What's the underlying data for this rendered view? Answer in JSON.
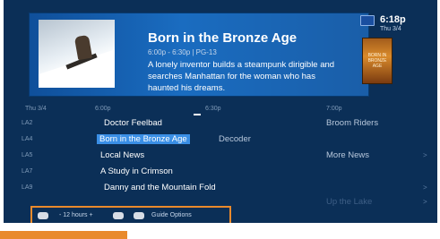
{
  "clock": {
    "time": "6:18p",
    "date": "Thu 3/4"
  },
  "info": {
    "title": "Born in the Bronze Age",
    "meta": "6:00p - 6:30p  |  PG-13",
    "description": "A lonely inventor builds a steampunk dirigible and searches Manhattan for the woman who has haunted his dreams.",
    "poster_text": "BORN IN BRONZE AGE"
  },
  "timeline": [
    "Thu 3/4",
    "6:00p",
    "6:30p",
    "7:00p"
  ],
  "rows": [
    {
      "channel": "LA2",
      "program": "Doctor Feelbad",
      "next": "Broom Riders",
      "arrow": ""
    },
    {
      "channel": "LA4",
      "program": "Born in the Bronze Age",
      "next": "Decoder",
      "arrow": ""
    },
    {
      "channel": "LA5",
      "program": "Local News",
      "next": "More News",
      "arrow": ">"
    },
    {
      "channel": "LA7",
      "program": "A Study in Crimson",
      "next": "",
      "arrow": ""
    },
    {
      "channel": "LA9",
      "program": "Danny and the Mountain Fold",
      "next": "",
      "arrow": ">"
    },
    {
      "channel": "",
      "program": "",
      "next": "Up the Lake",
      "arrow": ">"
    }
  ],
  "footer": {
    "hint_time": "- 12 hours +",
    "hint_options": "Guide Options"
  },
  "colors": {
    "accent": "#3a8fe6",
    "highlight_border": "#e98a2c",
    "panel": "#1a6cc0",
    "background": "#0b2f57"
  }
}
